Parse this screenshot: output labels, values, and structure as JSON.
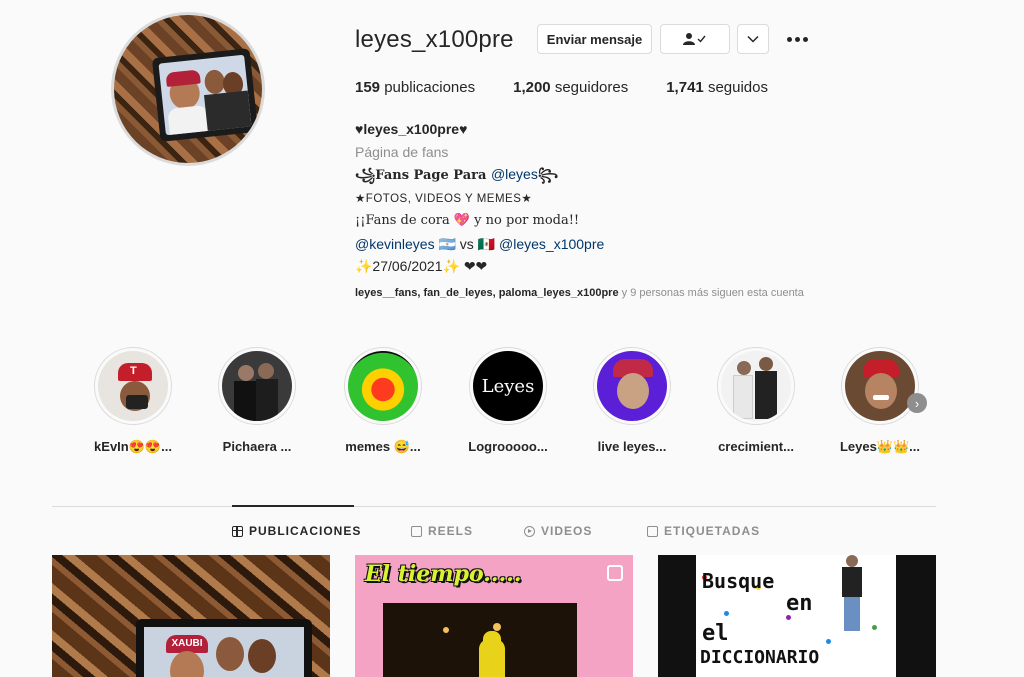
{
  "profile": {
    "username": "leyes_x100pre",
    "buttons": {
      "message": "Enviar mensaje",
      "follow_icon": "person-check-icon",
      "dropdown_icon": "chevron-down-icon",
      "more_icon": "more-dots-icon"
    },
    "stats": {
      "posts_count": "159",
      "posts_label": "publicaciones",
      "followers_count": "1,200",
      "followers_label": "seguidores",
      "following_count": "1,741",
      "following_label": "seguidos"
    },
    "bio": {
      "name": "♥leyes_x100pre♥",
      "category": "Página de fans",
      "line1_prefix": "꧁Fans Page Para ",
      "line1_mention": "@leyes",
      "line1_suffix": "꧂",
      "line2": "★FOTOS, VIDEOS Y MEMES★",
      "line3_text": "¡¡Fans de cora 💖 y no por moda!!",
      "line4_mention1": "@kevinleyes",
      "line4_flag1": "🇦🇷",
      "line4_vs": " vs ",
      "line4_flag2": "🇲🇽",
      "line4_mention2": "@leyes_x100pre",
      "line5": "✨27/06/2021✨ ❤❤"
    },
    "followed_by": {
      "names": "leyes__fans, fan_de_leyes, paloma_leyes_x100pre",
      "rest": " y 9 personas más siguen esta cuenta"
    }
  },
  "highlights": [
    {
      "label": "kEvIn😍😍..."
    },
    {
      "label": "Pichaera ..."
    },
    {
      "label": "memes 😅..."
    },
    {
      "label": "Logrooooo...",
      "cover_text": "Leyes"
    },
    {
      "label": "live leyes..."
    },
    {
      "label": "crecimient..."
    },
    {
      "label": "Leyes👑👑..."
    }
  ],
  "tabs": [
    {
      "label": "PUBLICACIONES",
      "icon": "grid-icon",
      "active": true
    },
    {
      "label": "REELS",
      "icon": "reels-icon",
      "active": false
    },
    {
      "label": "VIDEOS",
      "icon": "video-icon",
      "active": false
    },
    {
      "label": "ETIQUETADAS",
      "icon": "tagged-icon",
      "active": false
    }
  ],
  "posts": [
    {
      "cap_text": "XAUBI"
    },
    {
      "title": "El tiempo.....",
      "type": "carousel"
    },
    {
      "words": [
        "Busque",
        "en",
        "el",
        "DICCIONARIO"
      ]
    }
  ],
  "colors": {
    "background": "#fafafa",
    "text": "#262626",
    "secondary": "#8e8e8e",
    "link": "#00376b",
    "border": "#dbdbdb"
  }
}
